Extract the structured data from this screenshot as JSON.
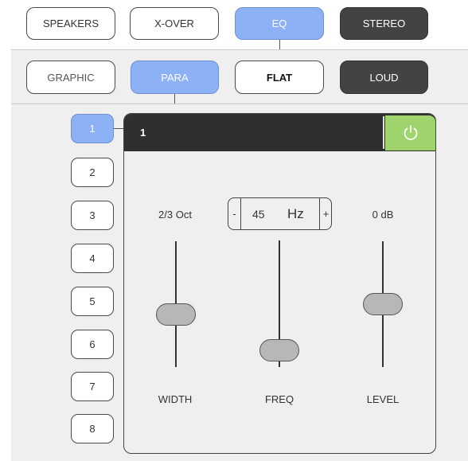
{
  "tabs_row1": [
    {
      "label": "SPEAKERS",
      "state": "normal"
    },
    {
      "label": "X-OVER",
      "state": "normal"
    },
    {
      "label": "EQ",
      "state": "active"
    },
    {
      "label": "STEREO",
      "state": "dark"
    }
  ],
  "tabs_row2": [
    {
      "label": "GRAPHIC",
      "state": "normal"
    },
    {
      "label": "PARA",
      "state": "active"
    },
    {
      "label": "FLAT",
      "state": "bold"
    },
    {
      "label": "LOUD",
      "state": "dark"
    }
  ],
  "bands": [
    "1",
    "2",
    "3",
    "4",
    "5",
    "6",
    "7",
    "8"
  ],
  "selected_band": "1",
  "band_panel": {
    "title": "1",
    "power": "on",
    "width": {
      "value": "2/3 Oct",
      "label": "WIDTH",
      "level": 0.4
    },
    "freq": {
      "minus": "-",
      "value": "45",
      "unit": "Hz",
      "plus": "+",
      "label": "FREQ",
      "level": 0.05
    },
    "level": {
      "value": "0 dB",
      "label": "LEVEL",
      "level": 0.5
    }
  },
  "colors": {
    "accent": "#8db1f5",
    "dark": "#434343",
    "power": "#9ed46b",
    "header": "#2f2f2f"
  }
}
